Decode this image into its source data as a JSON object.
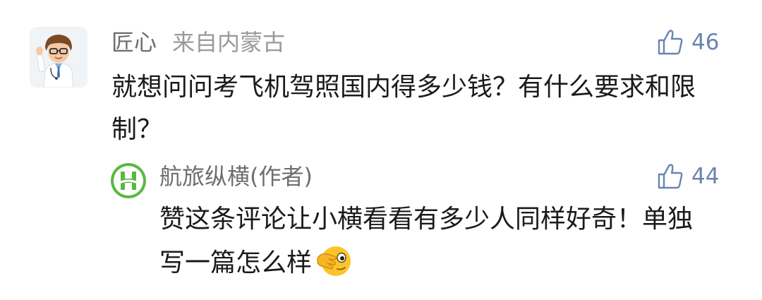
{
  "comment": {
    "user_name": "匠心",
    "location": "来自内蒙古",
    "like_count": "46",
    "text": "就想问问考飞机驾照国内得多少钱？有什么要求和限制？"
  },
  "reply": {
    "user_name": "航旅纵横",
    "author_tag": "(作者)",
    "like_count": "44",
    "text": "赞这条评论让小横看看有多少人同样好奇！单独写一篇怎么样",
    "emoji": "facepalm-peek-emoji"
  },
  "icons": {
    "like": "thumbs-up-icon",
    "avatar_main": "doctor-avatar",
    "avatar_reply": "hanglv-logo"
  },
  "colors": {
    "name": "#6e6e6e",
    "location": "#9a9a9a",
    "like": "#6a84b0",
    "text": "#1a1a1a",
    "logo_green": "#59b843"
  }
}
